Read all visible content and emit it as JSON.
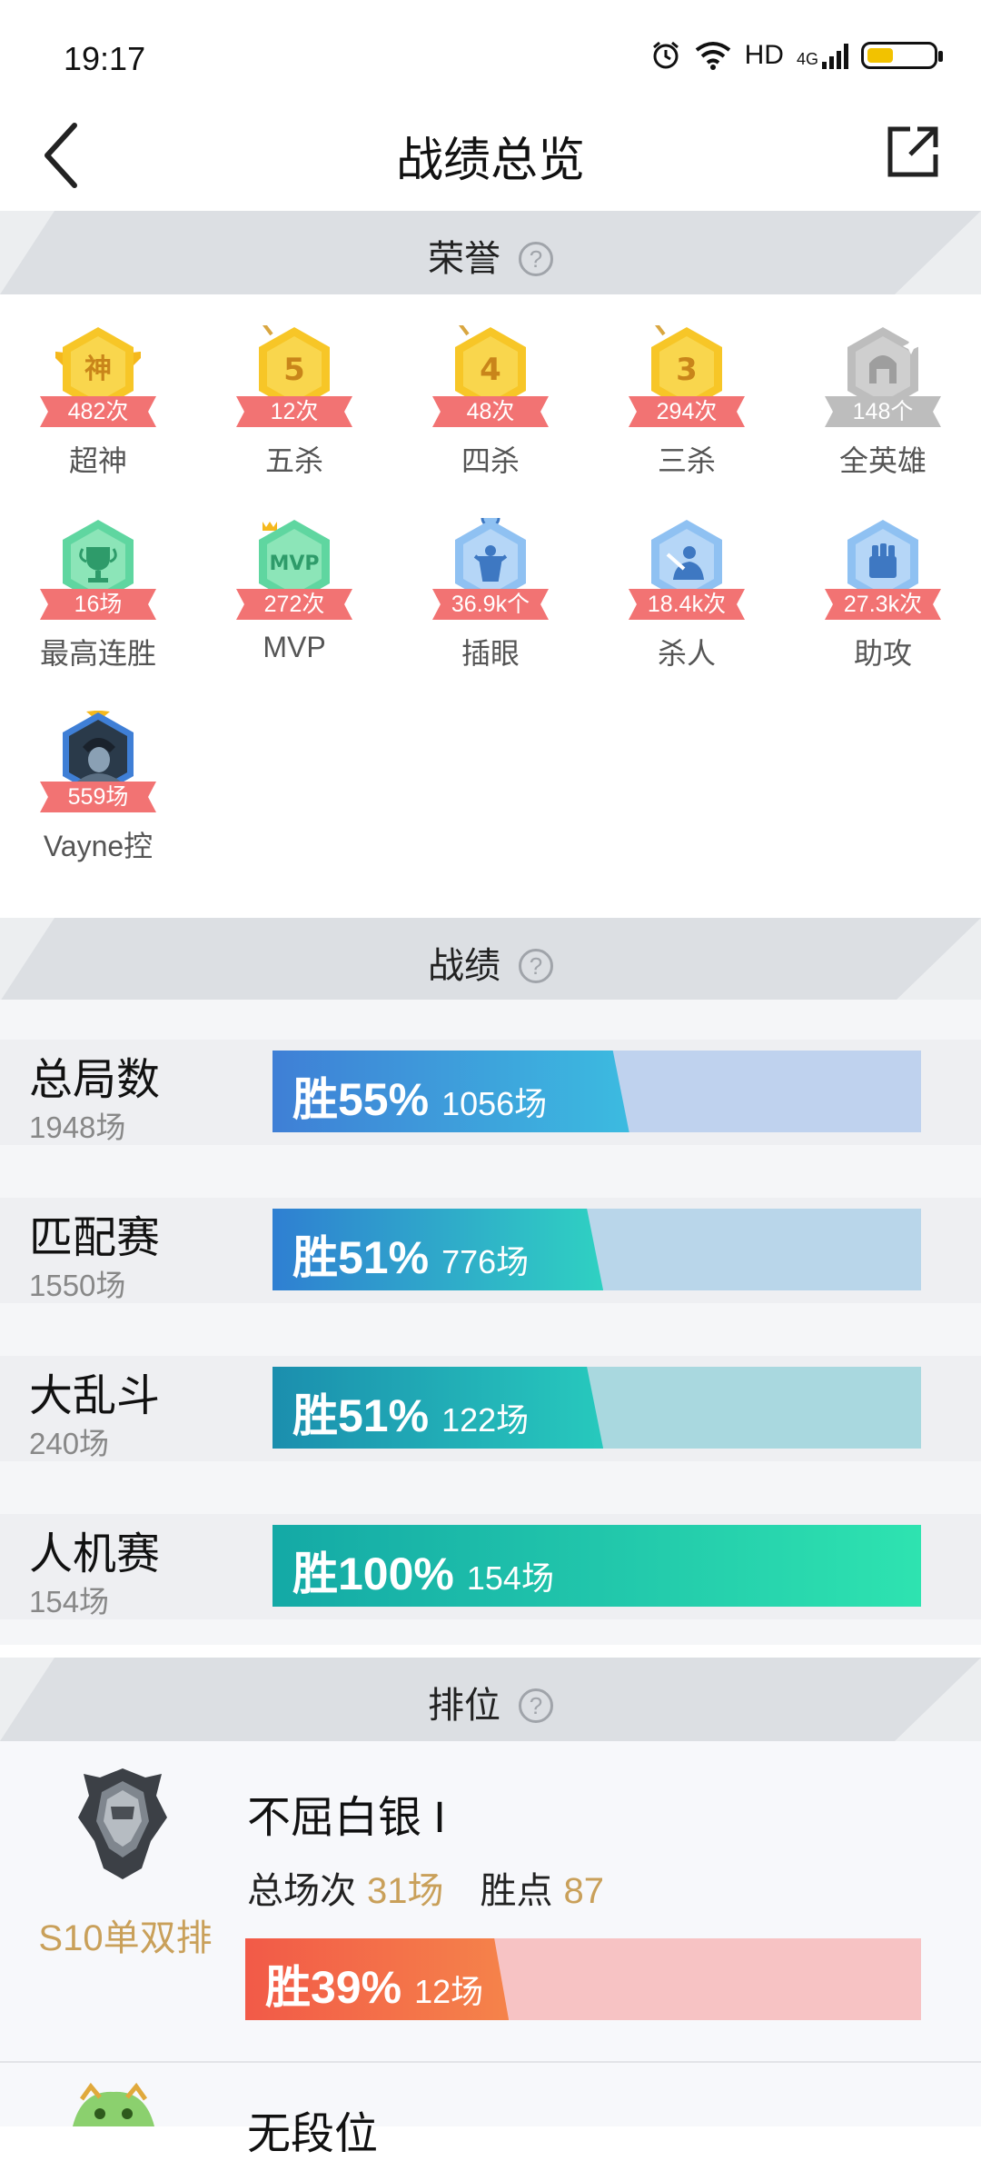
{
  "status_bar": {
    "time": "19:17",
    "network": "HD",
    "signal": "4G"
  },
  "header": {
    "title": "战绩总览"
  },
  "sections": {
    "honor": "荣誉",
    "records": "战绩",
    "rank": "排位",
    "help": "?"
  },
  "honors": [
    {
      "count": "482次",
      "label": "超神",
      "badge": "神",
      "color": "gold"
    },
    {
      "count": "12次",
      "label": "五杀",
      "badge": "5",
      "color": "gold"
    },
    {
      "count": "48次",
      "label": "四杀",
      "badge": "4",
      "color": "gold"
    },
    {
      "count": "294次",
      "label": "三杀",
      "badge": "3",
      "color": "gold"
    },
    {
      "count": "148个",
      "label": "全英雄",
      "badge": "helmet",
      "color": "gray"
    },
    {
      "count": "16场",
      "label": "最高连胜",
      "badge": "trophy",
      "color": "green"
    },
    {
      "count": "272次",
      "label": "MVP",
      "badge": "MVP",
      "color": "green"
    },
    {
      "count": "36.9k个",
      "label": "插眼",
      "badge": "ward",
      "color": "blue"
    },
    {
      "count": "18.4k次",
      "label": "杀人",
      "badge": "kill",
      "color": "blue"
    },
    {
      "count": "27.3k次",
      "label": "助攻",
      "badge": "assist",
      "color": "blue"
    },
    {
      "count": "559场",
      "label": "Vayne控",
      "badge": "champion",
      "color": "portrait"
    }
  ],
  "records": [
    {
      "name": "总局数",
      "total": "1948场",
      "win_text": "胜55%",
      "win_rate": 0.55,
      "games": "1056场",
      "c1": "#3f7fd6",
      "c2": "#3cbbe0",
      "bg": "#bfd2ee"
    },
    {
      "name": "匹配赛",
      "total": "1550场",
      "win_text": "胜51%",
      "win_rate": 0.51,
      "games": "776场",
      "c1": "#2f7fd2",
      "c2": "#2fd1c2",
      "bg": "#b9d6ea"
    },
    {
      "name": "大乱斗",
      "total": "240场",
      "win_text": "胜51%",
      "win_rate": 0.51,
      "games": "122场",
      "c1": "#1b8eae",
      "c2": "#27c9bd",
      "bg": "#a9d8df"
    },
    {
      "name": "人机赛",
      "total": "154场",
      "win_text": "胜100%",
      "win_rate": 1.0,
      "games": "154场",
      "c1": "#14a9a6",
      "c2": "#2ee3b0",
      "bg": "#a9e6d6"
    }
  ],
  "rank": {
    "season": "S10单双排",
    "tier": "不屈白银 I",
    "total_label": "总场次",
    "total_value": "31场",
    "points_label": "胜点",
    "points_value": "87",
    "win_text": "胜39%",
    "win_rate": 0.39,
    "games": "12场",
    "next_tier": "无段位"
  }
}
